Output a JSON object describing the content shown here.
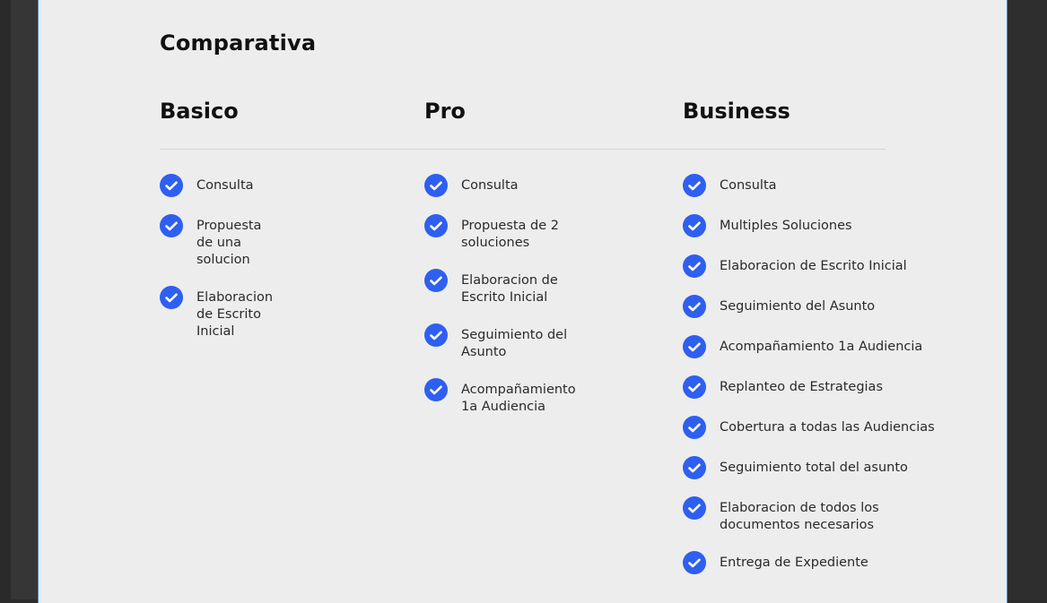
{
  "page": {
    "title": "Comparativa"
  },
  "colors": {
    "accent": "#2f5ff0",
    "background": "#ededed",
    "frame_border": "#3d8fe0"
  },
  "plans": [
    {
      "name": "Basico",
      "features": [
        "Consulta",
        "Propuesta de una solucion",
        "Elaboracion de Escrito Inicial"
      ]
    },
    {
      "name": "Pro",
      "features": [
        "Consulta",
        "Propuesta de 2 soluciones",
        "Elaboracion de Escrito Inicial",
        "Seguimiento del Asunto",
        "Acompañamiento 1a Audiencia"
      ]
    },
    {
      "name": "Business",
      "features": [
        "Consulta",
        "Multiples Soluciones",
        "Elaboracion de Escrito Inicial",
        "Seguimiento del Asunto",
        "Acompañamiento 1a Audiencia",
        "Replanteo de Estrategias",
        "Cobertura a todas las Audiencias",
        "Seguimiento total del asunto",
        "Elaboracion de todos los documentos necesarios",
        "Entrega de Expediente"
      ]
    }
  ],
  "icons": {
    "feature_check": "check-circle-icon"
  }
}
